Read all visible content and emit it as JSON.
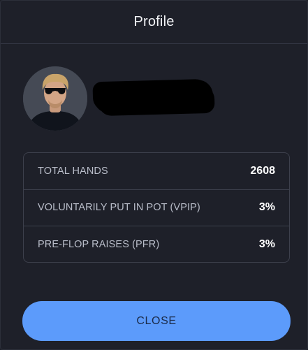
{
  "header": {
    "title": "Profile"
  },
  "profile": {
    "avatar_icon": "user-avatar-photo",
    "name_redacted": true
  },
  "stats": [
    {
      "label": "TOTAL HANDS",
      "value": "2608"
    },
    {
      "label": "VOLUNTARILY PUT IN POT (VPIP)",
      "value": "3%"
    },
    {
      "label": "PRE-FLOP RAISES (PFR)",
      "value": "3%"
    }
  ],
  "actions": {
    "close_label": "CLOSE"
  },
  "colors": {
    "background": "#1e2029",
    "accent": "#5c9bfb",
    "border": "#3d404c",
    "label_text": "#b8bcc8",
    "value_text": "#ffffff"
  }
}
